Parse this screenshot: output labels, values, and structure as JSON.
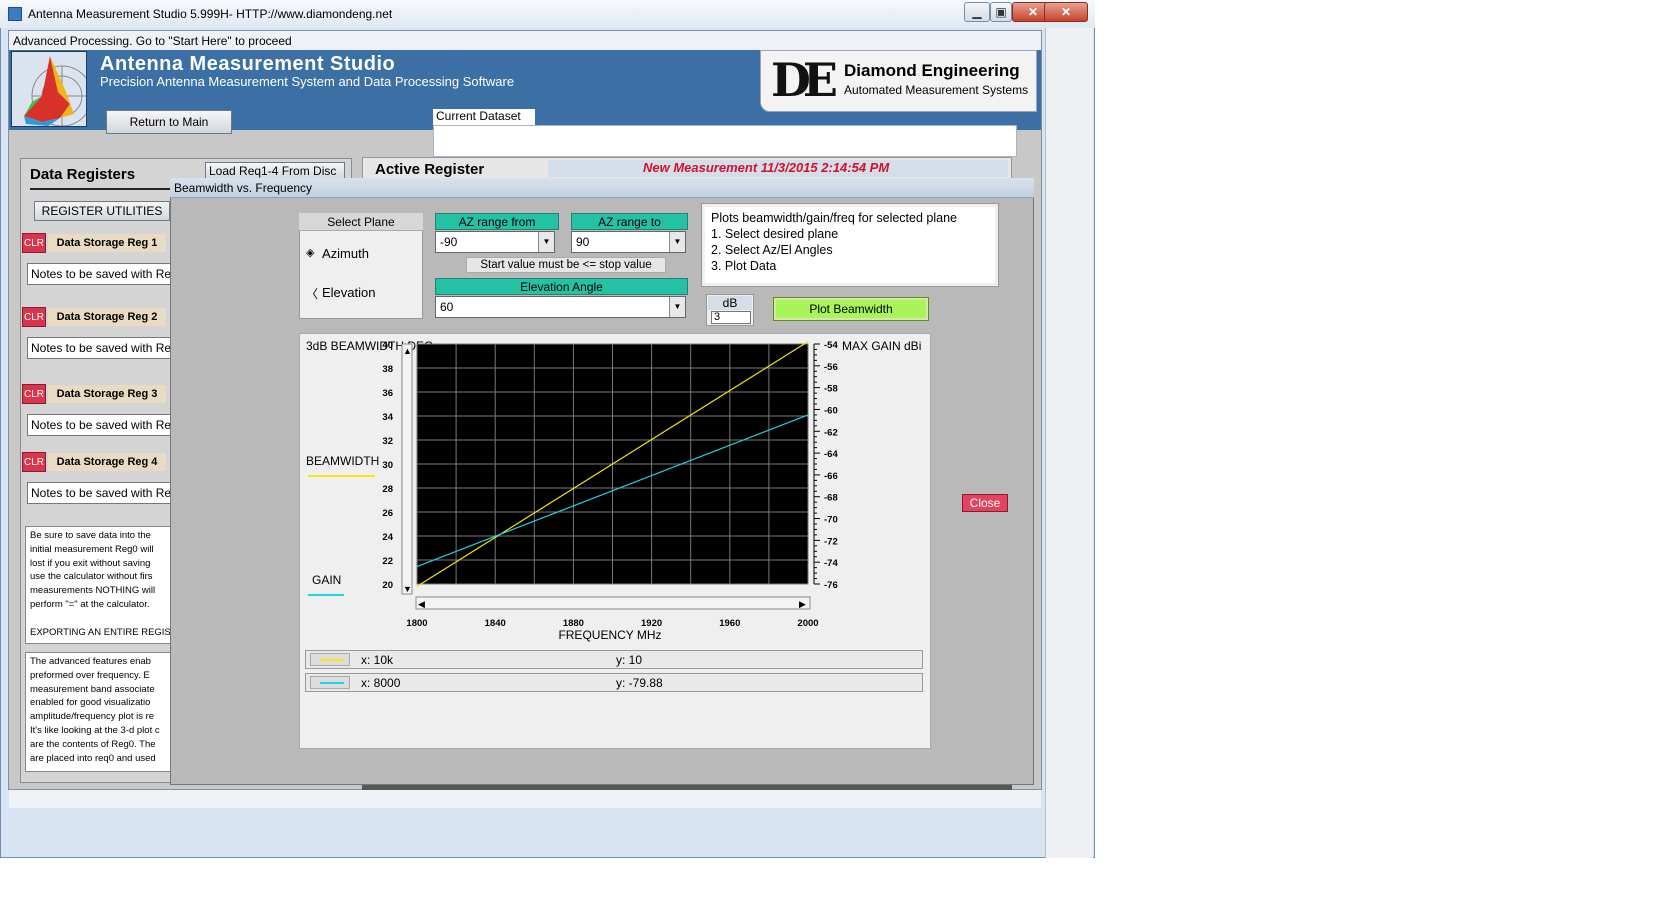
{
  "window": {
    "title": "Antenna Measurement Studio 5.999H- HTTP://www.diamondeng.net",
    "controls": [
      "minimize",
      "maximize",
      "close"
    ]
  },
  "status_bar": "Advanced Processing.  Go to \"Start Here\" to proceed",
  "header": {
    "title": "Antenna Measurement Studio",
    "subtitle": "Precision Antenna Measurement System and Data Processing Software",
    "company_mark": "DE",
    "company_name": "Diamond Engineering",
    "company_tagline": "Automated Measurement Systems",
    "return_button": "Return to Main",
    "dataset_label": "Current Dataset",
    "dataset_value": ""
  },
  "registers": {
    "heading": "Data Registers",
    "load_button": "Load Req1-4 From Disc",
    "utilities_button": "REGISTER UTILITIES",
    "clr_label": "CLR",
    "items": [
      {
        "name": "Data Storage Reg 1",
        "note": "Notes to be saved with Re"
      },
      {
        "name": "Data Storage Reg 2",
        "note": "Notes to be saved with Re"
      },
      {
        "name": "Data Storage Reg 3",
        "note": "Notes to be saved with Re"
      },
      {
        "name": "Data Storage Reg 4",
        "note": "Notes to be saved with Re"
      }
    ],
    "info1": [
      "Be sure to save data into the",
      "initial measurement Reg0 will",
      "lost if you exit without saving",
      "use the calculator without firs",
      "measurements  NOTHING will",
      "perform \"=\"  at the calculator.",
      "",
      "EXPORTING AN ENTIRE REGIS"
    ],
    "info2": [
      "The advanced features enab",
      "preformed over frequency.  E",
      "measurement band associate",
      "enabled for good visualizatio",
      "amplitude/frequency plot is re",
      "It's like looking at the 3-d plot c",
      "are the contents of Reg0. The",
      "are placed into req0 and used"
    ]
  },
  "active_register": {
    "label": "Active Register",
    "value": "New Measurement  11/3/2015 2:14:54 PM"
  },
  "dialog": {
    "title": "Beamwidth vs. Frequency",
    "select_plane": "Select Plane",
    "plane_options": [
      "Azimuth",
      "Elevation"
    ],
    "selected_plane": "Azimuth",
    "az_from_label": "AZ range from",
    "az_from_value": "-90",
    "az_to_label": "AZ range to",
    "az_to_value": "90",
    "start_note": "Start value must be <= stop value",
    "elevation_label": "Elevation Angle",
    "elevation_value": "60",
    "instructions": [
      "Plots beamwidth/gain/freq for selected plane",
      "1. Select desired plane",
      "2. Select Az/El Angles",
      "3. Plot Data"
    ],
    "db_label": "dB",
    "db_value": "3",
    "plot_button": "Plot Beamwidth",
    "close_button": "Close",
    "legend": [
      {
        "color": "#f5e614",
        "x_text": "x: 10k",
        "y_text": "y: 10"
      },
      {
        "color": "#22d3e6",
        "x_text": "x: 8000",
        "y_text": "y: -79.88"
      }
    ]
  },
  "chart_data": {
    "type": "line",
    "left_axis_title": "3dB BEAMWIDTH DEG.",
    "right_axis_title": "MAX GAIN dBi",
    "xlabel": "FREQUENCY MHz",
    "xlim": [
      1800,
      2000
    ],
    "x_ticks": [
      1800,
      1840,
      1880,
      1920,
      1960,
      2000
    ],
    "y_left_lim": [
      20,
      40
    ],
    "y_left_ticks": [
      20,
      22,
      24,
      26,
      28,
      30,
      32,
      34,
      36,
      38,
      40
    ],
    "y_right_lim": [
      -76,
      -54
    ],
    "y_right_ticks": [
      -54,
      -56,
      -58,
      -60,
      -62,
      -64,
      -66,
      -68,
      -70,
      -72,
      -74,
      -76
    ],
    "grid": true,
    "background": "#000000",
    "series": [
      {
        "name": "BEAMWIDTH",
        "axis": "left",
        "color": "#f5e614",
        "x": [
          1800,
          2000
        ],
        "y": [
          19.8,
          40.2
        ]
      },
      {
        "name": "GAIN",
        "axis": "right",
        "color": "#22d3e6",
        "x": [
          1800,
          2000
        ],
        "y": [
          -74.4,
          -60.5
        ]
      }
    ]
  }
}
